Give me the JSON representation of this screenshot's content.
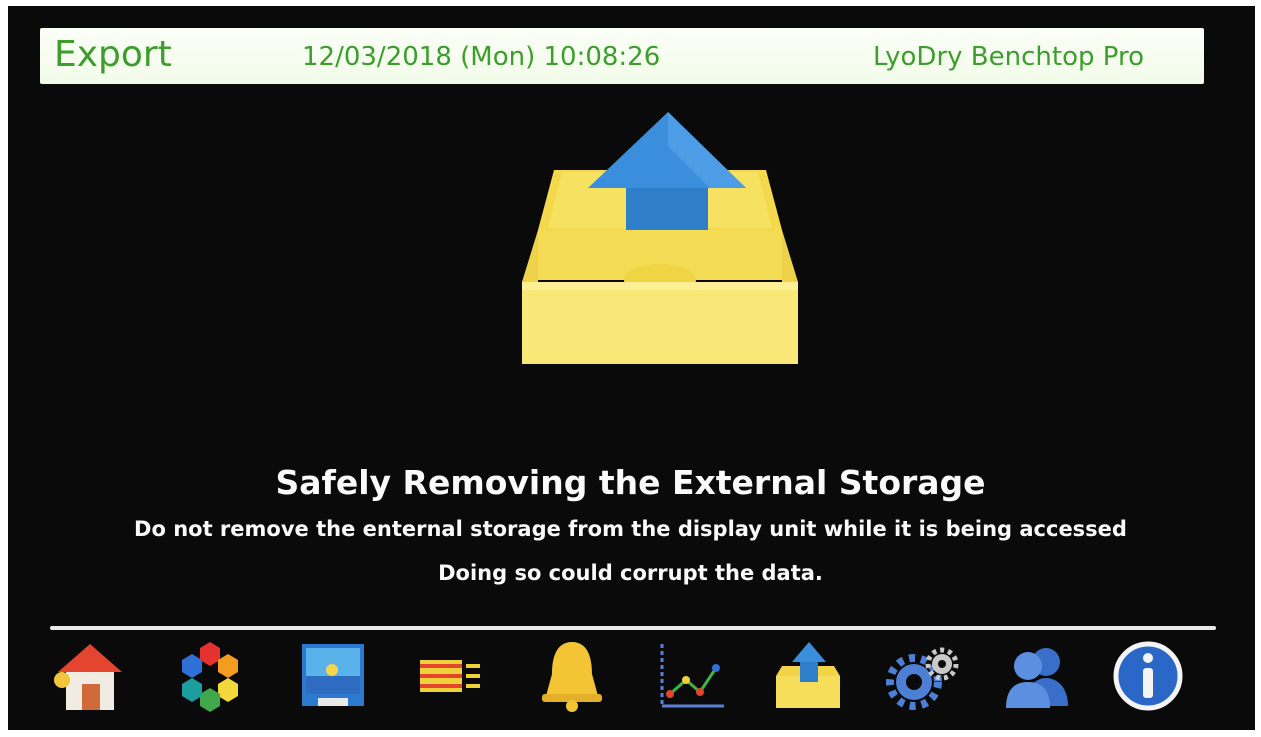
{
  "header": {
    "title": "Export",
    "datetime": "12/03/2018 (Mon) 10:08:26",
    "device_name": "LyoDry Benchtop Pro"
  },
  "hero": {
    "icon": "export-tray-icon"
  },
  "message": {
    "headline": "Safely Removing the External Storage",
    "line1": "Do not remove the enternal storage from the display unit while it is being accessed",
    "line2": "Doing so could corrupt the data."
  },
  "nav": {
    "items": [
      {
        "name": "home",
        "icon": "home-icon"
      },
      {
        "name": "process",
        "icon": "hexagon-cluster-icon"
      },
      {
        "name": "display",
        "icon": "screen-icon"
      },
      {
        "name": "batch",
        "icon": "batch-bars-icon"
      },
      {
        "name": "alarms",
        "icon": "bell-icon"
      },
      {
        "name": "trend",
        "icon": "line-graph-icon"
      },
      {
        "name": "export",
        "icon": "export-tray-icon"
      },
      {
        "name": "settings",
        "icon": "gears-icon"
      },
      {
        "name": "users",
        "icon": "users-icon"
      },
      {
        "name": "info",
        "icon": "info-icon"
      }
    ]
  },
  "colors": {
    "header_text": "#3d9e2d",
    "header_bg": "#f6fdf0",
    "screen_bg": "#0a0a0a",
    "tray_yellow": "#f8e36a",
    "arrow_blue": "#3b8edb"
  }
}
